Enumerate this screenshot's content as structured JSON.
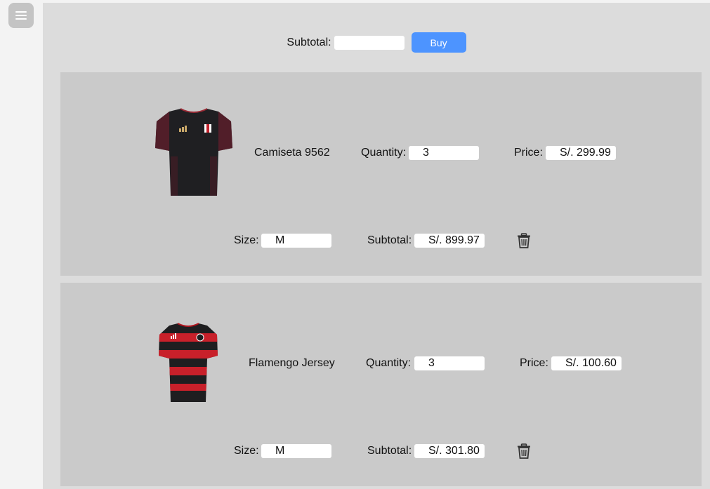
{
  "header": {
    "menu_icon": "hamburger-menu-icon",
    "subtotal_label": "Subtotal:",
    "subtotal_value": "",
    "buy_label": "Buy",
    "buy_color": "#4d94ff"
  },
  "items": [
    {
      "name": "Camiseta 9562",
      "image_icon": "black-jersey-image",
      "quantity_label": "Quantity:",
      "quantity": "3",
      "price_label": "Price:",
      "price": "S/. 299.99",
      "size_label": "Size:",
      "size": "M",
      "subtotal_label": "Subtotal:",
      "subtotal": "S/. 899.97",
      "delete_icon": "trash-icon"
    },
    {
      "name": "Flamengo Jersey",
      "image_icon": "red-black-striped-jersey-image",
      "quantity_label": "Quantity:",
      "quantity": "3",
      "price_label": "Price:",
      "price": "S/. 100.60",
      "size_label": "Size:",
      "size": "M",
      "subtotal_label": "Subtotal:",
      "subtotal": "S/. 301.80",
      "delete_icon": "trash-icon"
    }
  ]
}
